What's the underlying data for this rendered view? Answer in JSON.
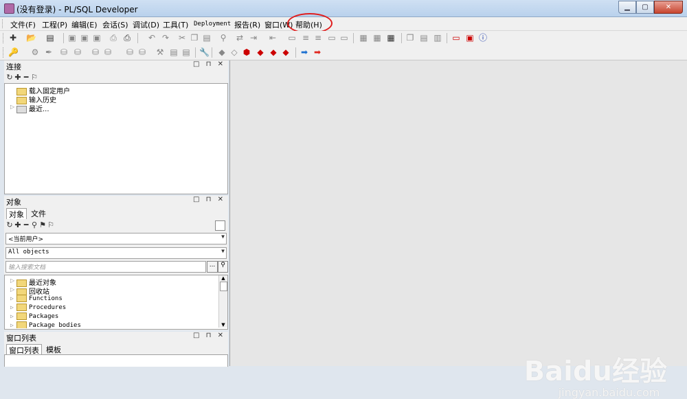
{
  "window": {
    "title": "(没有登录) - PL/SQL Developer"
  },
  "menu": [
    "文件(F)",
    "工程(P)",
    "编辑(E)",
    "会话(S)",
    "调试(D)",
    "工具(T)",
    "Deployment",
    "报告(R)",
    "窗口(W)",
    "帮助(H)"
  ],
  "connection_panel": {
    "title": "连接",
    "items": [
      "载入固定用户",
      "输入历史",
      "最近..."
    ]
  },
  "object_panel": {
    "title": "对象",
    "tabs": [
      "对象",
      "文件"
    ],
    "user_combo": "<当前用户>",
    "filter_combo": "All objects",
    "search_placeholder": "输入搜索文档",
    "search_btn": "...",
    "items": [
      "最近对象",
      "回收站",
      "Functions",
      "Procedures",
      "Packages",
      "Package bodies"
    ]
  },
  "window_list_panel": {
    "title": "窗口列表",
    "tabs": [
      "窗口列表",
      "模板"
    ]
  },
  "watermark": {
    "main": "Baidu经验",
    "sub": "jingyan.baidu.com"
  }
}
